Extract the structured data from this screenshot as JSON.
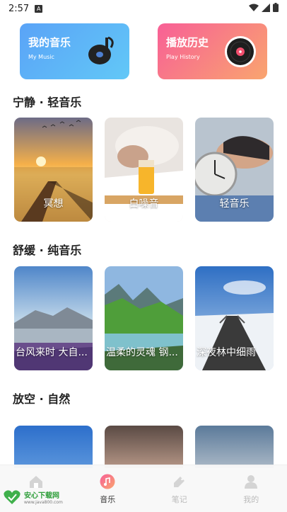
{
  "status_bar": {
    "time": "2:57",
    "notif": "A"
  },
  "cards": [
    {
      "title": "我的音乐",
      "subtitle": "My Music",
      "icon": "music-disc-icon"
    },
    {
      "title": "播放历史",
      "subtitle": "Play History",
      "icon": "vinyl-record-icon"
    }
  ],
  "sections": [
    {
      "title": "宁静 · 轻音乐",
      "items": [
        "冥想",
        "白噪音",
        "轻音乐"
      ]
    },
    {
      "title": "舒缓 · 纯音乐",
      "items": [
        "台风来时 大自...",
        "温柔的灵魂 钢...",
        "深夜林中细雨"
      ]
    },
    {
      "title": "放空 · 自然",
      "items": []
    }
  ],
  "tabs": [
    {
      "label": "",
      "icon": "home-icon",
      "active": false
    },
    {
      "label": "音乐",
      "icon": "music-icon",
      "active": true
    },
    {
      "label": "笔记",
      "icon": "note-icon",
      "active": false
    },
    {
      "label": "我的",
      "icon": "profile-icon",
      "active": false
    }
  ],
  "watermark": {
    "text": "安心下载网",
    "sub": "www.java800.com"
  },
  "colors": {
    "card_music": "#5aa3f7",
    "card_history": "#f85f96",
    "accent": "#f85f96"
  }
}
